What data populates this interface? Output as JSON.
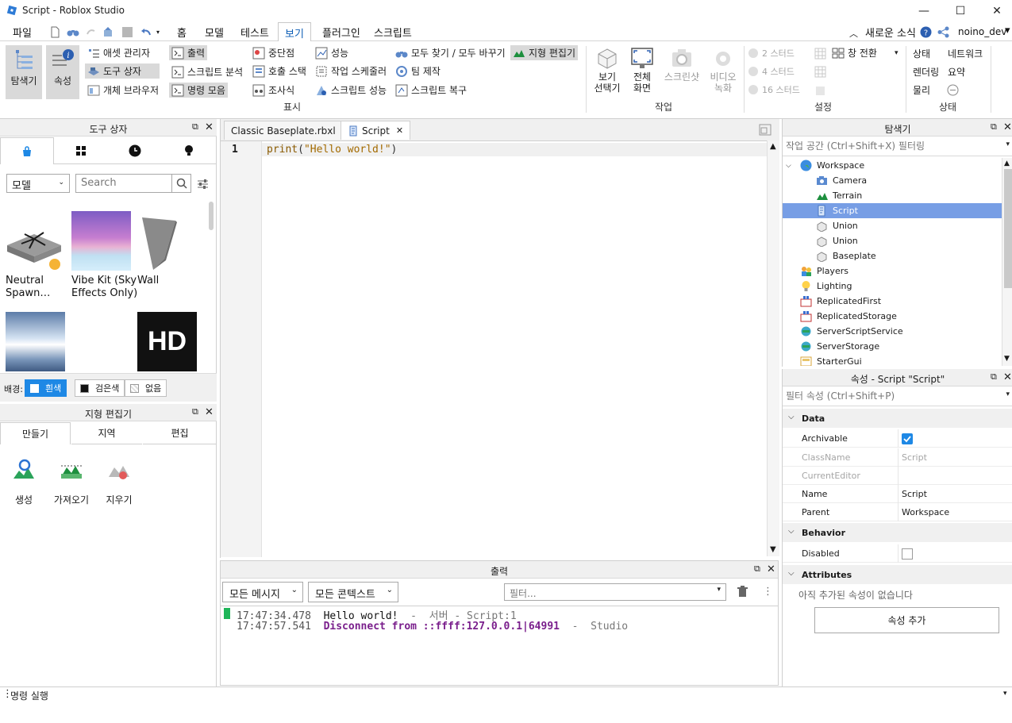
{
  "window": {
    "title": "Script - Roblox Studio",
    "controls": {
      "minimize": "—",
      "maximize": "☐",
      "close": "✕"
    }
  },
  "menu": {
    "file": "파일",
    "tabs": [
      "홈",
      "모델",
      "테스트",
      "보기",
      "플러그인",
      "스크립트"
    ],
    "active_tab": "보기",
    "news": "새로운 소식",
    "username": "noino_dev"
  },
  "ribbon": {
    "explorer": "탐색기",
    "properties": "속성",
    "asset_manager": "애셋 관리자",
    "toolbox": "도구 상자",
    "object_browser": "개체 브라우저",
    "output": "출력",
    "script_analysis": "스크립트 분석",
    "command_bar": "명령 모음",
    "breakpoints": "중단점",
    "call_stack": "호출 스택",
    "watch": "조사식",
    "performance": "성능",
    "task_scheduler": "작업 스케줄러",
    "script_performance": "스크립트 성능",
    "find_replace": "모두 찾기 / 모두 바꾸기",
    "team_create": "팀 제작",
    "script_recovery": "스크립트 복구",
    "terrain_editor": "지형 편집기",
    "group_show": "표시",
    "view_selector_1": "보기",
    "view_selector_2": "선택기",
    "fullscreen_1": "전체",
    "fullscreen_2": "화면",
    "screenshot": "스크린샷",
    "video_1": "비디오",
    "video_2": "녹화",
    "group_actions": "작업",
    "stud2": "2 스터드",
    "stud4": "4 스터드",
    "stud16": "16 스터드",
    "switch_windows": "창 전환",
    "group_settings": "설정",
    "stats": "상태",
    "network": "네트워크",
    "render": "렌더링",
    "summary": "요약",
    "physics": "물리",
    "group_stats": "상태"
  },
  "toolbox": {
    "title": "도구 상자",
    "category": "모델",
    "search_placeholder": "Search",
    "items": [
      {
        "line1": "Neutral",
        "line2": "Spawn…"
      },
      {
        "line1": "Vibe Kit (Sky",
        "line2": "Effects Only)"
      },
      {
        "line1": "Wall",
        "line2": ""
      }
    ],
    "hd_label": "HD",
    "bg_label": "배경:",
    "bg_white": "흰색",
    "bg_black": "검은색",
    "bg_none": "없음"
  },
  "terrain": {
    "title": "지형 편집기",
    "tabs": [
      "만들기",
      "지역",
      "편집"
    ],
    "tools": [
      "생성",
      "가져오기",
      "지우기"
    ]
  },
  "editor": {
    "tabs": [
      {
        "label": "Classic Baseplate.rbxl"
      },
      {
        "label": "Script"
      }
    ],
    "line_number": "1",
    "code_fn": "print",
    "code_open": "(",
    "code_str": "\"Hello world!\"",
    "code_close": ")"
  },
  "output": {
    "title": "출력",
    "filter_messages": "모든 메시지",
    "filter_context": "모든 콘텍스트",
    "filter_placeholder": "필터...",
    "lines": [
      {
        "time": "17:47:34.478",
        "msg": "Hello world!",
        "sep": "-",
        "ctx": "서버",
        "src": "- Script:1"
      },
      {
        "time": "17:47:57.541",
        "msg": "Disconnect from ::ffff:127.0.0.1|64991",
        "sep": "-",
        "ctx": "Studio"
      }
    ]
  },
  "explorer": {
    "title": "탐색기",
    "filter_placeholder": "작업 공간 (Ctrl+Shift+X) 필터링",
    "items": [
      "Workspace",
      "Camera",
      "Terrain",
      "Script",
      "Union",
      "Union",
      "Baseplate",
      "Players",
      "Lighting",
      "ReplicatedFirst",
      "ReplicatedStorage",
      "ServerScriptService",
      "ServerStorage",
      "StarterGui"
    ]
  },
  "properties": {
    "title": "속성 - Script \"Script\"",
    "filter_placeholder": "필터 속성 (Ctrl+Shift+P)",
    "sec_data": "Data",
    "archivable": "Archivable",
    "classname": "ClassName",
    "classname_val": "Script",
    "current_editor": "CurrentEditor",
    "name": "Name",
    "name_val": "Script",
    "parent": "Parent",
    "parent_val": "Workspace",
    "sec_behavior": "Behavior",
    "disabled": "Disabled",
    "sec_attributes": "Attributes",
    "no_attributes": "아직 추가된 속성이 없습니다",
    "add_attribute": "속성 추가"
  },
  "command_bar": {
    "placeholder": "명령 실행"
  }
}
